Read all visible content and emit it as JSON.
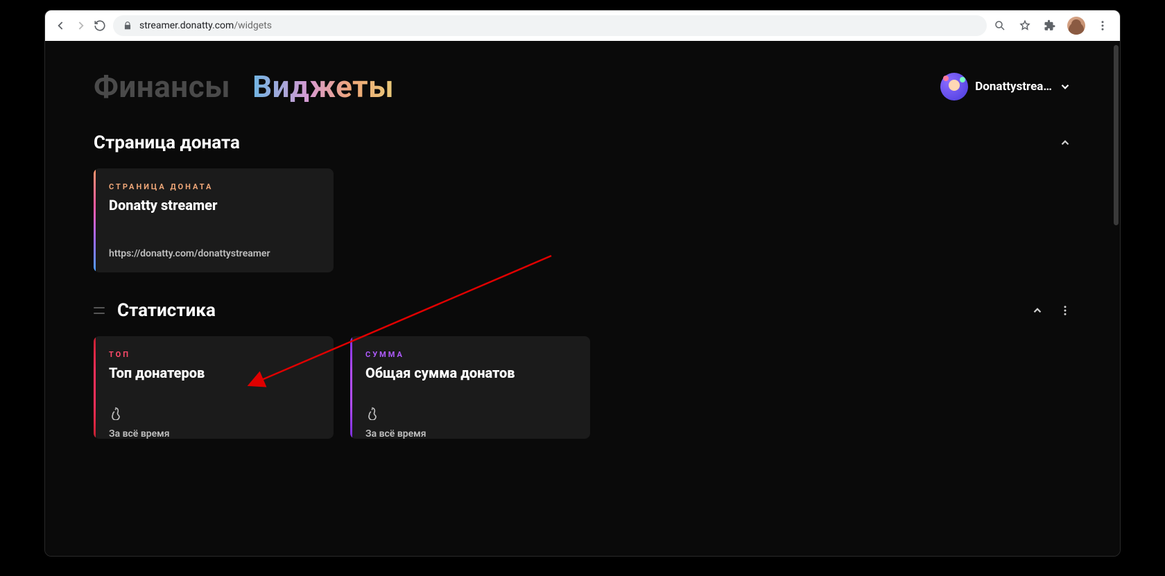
{
  "browser": {
    "url_host": "streamer.donatty.com",
    "url_path": "/widgets"
  },
  "header": {
    "tabs": {
      "finance": "Финансы",
      "widgets": "Виджеты"
    },
    "user_name": "Donattystrea…"
  },
  "sections": {
    "donate_page": {
      "title": "Страница доната",
      "card": {
        "tag": "СТРАНИЦА ДОНАТА",
        "title": "Donatty streamer",
        "link": "https://donatty.com/donattystreamer"
      }
    },
    "stats": {
      "title": "Статистика",
      "cards": [
        {
          "tag": "ТОП",
          "title": "Топ донатеров",
          "meta": "За всё время"
        },
        {
          "tag": "СУММА",
          "title": "Общая сумма донатов",
          "meta": "За всё время"
        }
      ]
    }
  }
}
